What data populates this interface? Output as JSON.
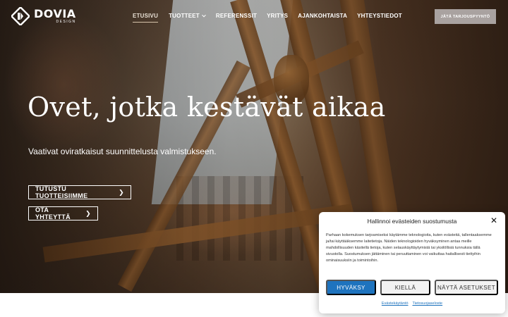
{
  "header": {
    "logo": {
      "name": "DOVIA",
      "sub": "DESIGN"
    },
    "nav": [
      {
        "label": "ETUSIVU",
        "active": true
      },
      {
        "label": "TUOTTEET",
        "dropdown": true
      },
      {
        "label": "REFERENSSIT"
      },
      {
        "label": "YRITYS"
      },
      {
        "label": "AJANKOHTAISTA"
      },
      {
        "label": "YHTEYSTIEDOT"
      }
    ],
    "cta_label": "JÄTÄ TARJOUSPYYNTÖ"
  },
  "hero": {
    "headline": "Ovet, jotka kestävät aikaa",
    "subline": "Vaativat oviratkaisut suunnittelusta valmistukseen.",
    "button_products": "TUTUSTU TUOTTEISIIMME",
    "button_contact": "OTA YHTEYTTÄ",
    "arrow": "❯"
  },
  "cookie": {
    "title": "Hallinnoi evästeiden suostumusta",
    "close": "✕",
    "body": "Parhaan kokemuksen tarjoamiseksi käytämme teknologioita, kuten evästeitä, tallentaaksemme ja/tai käyttääksemme laitetietoja. Näiden teknologioiden hyväksyminen antaa meille mahdollisuuden käsitellä tietoja, kuten selauskäyttäytymistä tai yksilöllisiä tunnuksia tällä sivustolla. Suostumuksen jättäminen tai peruuttaminen voi vaikuttaa haitallisesti tiettyihin ominaisuuksiin ja toimintoihin.",
    "accept": "HYVÄKSY",
    "deny": "KIELLÄ",
    "settings": "NÄYTÄ ASETUKSET",
    "link_cookie_policy": "Evästekäytäntö",
    "link_privacy": "Tietosuojaseloste"
  },
  "colors": {
    "accept": "#1e73be",
    "cta": "#a9a2a0"
  }
}
